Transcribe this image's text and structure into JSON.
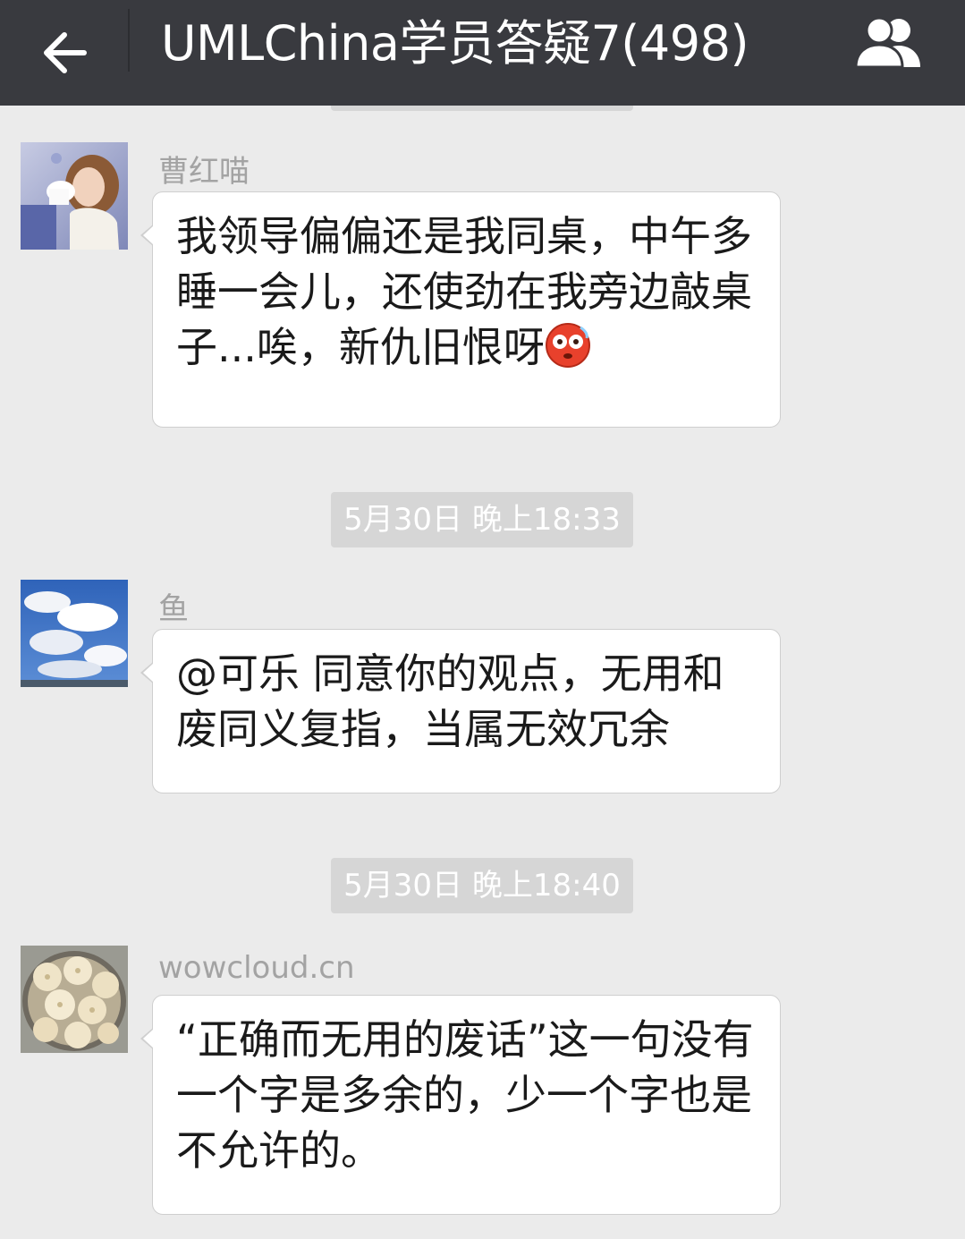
{
  "header": {
    "title": "UMLChina学员答疑7(498)",
    "back_icon": "arrow-left-icon",
    "members_icon": "group-members-icon",
    "bg_color": "#393a3f"
  },
  "messages": [
    {
      "sender": "曹红喵",
      "avatar": "girl-photo",
      "text": "我领导偏偏还是我同桌，中午多睡一会儿，还使劲在我旁边敲桌子...唉，新仇旧恨呀",
      "emoji": "flushed-face-emoji"
    },
    {
      "sender": "鱼",
      "avatar": "sky-clouds-photo",
      "text": "@可乐 同意你的观点，无用和废同义复指，当属无效冗余"
    },
    {
      "sender": "wowcloud.cn",
      "avatar": "steamed-buns-photo",
      "text": "“正确而无用的废话”这一句没有一个字是多余的，少一个字也是不允许的。"
    }
  ],
  "timestamps": [
    "5月30日 晚上18:33",
    "5月30日 晚上18:40"
  ]
}
